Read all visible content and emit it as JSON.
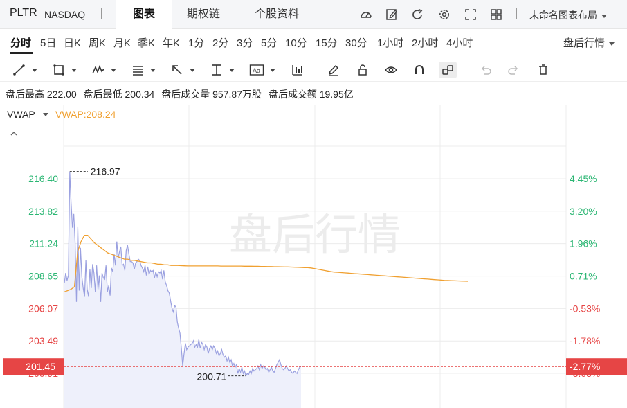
{
  "header": {
    "ticker": "PLTR",
    "exchange": "NASDAQ",
    "tabs": [
      {
        "label": "图表",
        "active": true
      },
      {
        "label": "期权链",
        "active": false
      },
      {
        "label": "个股资料",
        "active": false
      }
    ],
    "layout_name": "未命名图表布局"
  },
  "periods": [
    {
      "label": "分时",
      "active": true
    },
    {
      "label": "5日"
    },
    {
      "label": "日K"
    },
    {
      "label": "周K"
    },
    {
      "label": "月K"
    },
    {
      "label": "季K"
    },
    {
      "label": "年K"
    },
    {
      "label": "1分"
    },
    {
      "label": "2分"
    },
    {
      "label": "3分"
    },
    {
      "label": "5分"
    },
    {
      "label": "10分"
    },
    {
      "label": "15分"
    },
    {
      "label": "30分"
    },
    {
      "label": "1小时"
    },
    {
      "label": "2小时"
    },
    {
      "label": "4小时"
    }
  ],
  "session_selector": "盘后行情",
  "stats": {
    "high_label": "盘后最高",
    "high_value": "222.00",
    "low_label": "盘后最低",
    "low_value": "200.34",
    "volume_label": "盘后成交量",
    "volume_value": "957.87万股",
    "turnover_label": "盘后成交额",
    "turnover_value": "19.95亿"
  },
  "indicator": {
    "name": "VWAP",
    "value_text": "VWAP:208.24"
  },
  "colors": {
    "price_line": "#9aa0e0",
    "price_fill": "#eef0fb",
    "vwap": "#f0a030",
    "up": "#2bb673",
    "down": "#e64545",
    "grid": "#ececec"
  },
  "chart_data": {
    "type": "line",
    "watermark": "盘后行情",
    "y_price_ticks": [
      "216.40",
      "213.82",
      "211.24",
      "208.65",
      "206.07",
      "203.49",
      "200.91"
    ],
    "y_price_values": [
      216.4,
      213.82,
      211.24,
      208.65,
      206.07,
      203.49,
      200.91
    ],
    "y_pct_ticks": [
      "4.45%",
      "3.20%",
      "1.96%",
      "0.71%",
      "-0.53%",
      "-1.78%",
      "-3.03%"
    ],
    "last_price": {
      "value": 201.45,
      "label": "201.45",
      "pct_label": "-2.77%"
    },
    "max_annotation": {
      "value": 216.97,
      "label": "216.97"
    },
    "min_annotation": {
      "value": 200.71,
      "label": "200.71"
    },
    "x": [
      0,
      2,
      4,
      6,
      8,
      10,
      12,
      14,
      16,
      18,
      20,
      22,
      24,
      26,
      28,
      30,
      32,
      34,
      36,
      38,
      40,
      42,
      44,
      46,
      48,
      50,
      52,
      54,
      56,
      58,
      60,
      62,
      64,
      66,
      68,
      70,
      72,
      74,
      76,
      78,
      80,
      82,
      84,
      86,
      88,
      90,
      92,
      94,
      96,
      98,
      100,
      102,
      104,
      106,
      108,
      110,
      112,
      114,
      116,
      118,
      120,
      122,
      124,
      126,
      128,
      130,
      132,
      134,
      136,
      138,
      140,
      142,
      144,
      146,
      148,
      150,
      152,
      154,
      156,
      158,
      160,
      162,
      164,
      166,
      168,
      170,
      172,
      174,
      176,
      178,
      180,
      182,
      184,
      186,
      188,
      190,
      192,
      194,
      196,
      198,
      200,
      202,
      204,
      206,
      208,
      210,
      212,
      214,
      216,
      218,
      220,
      222,
      224,
      226,
      228,
      230,
      232,
      234,
      236,
      238,
      240,
      242,
      244,
      246,
      248,
      250,
      252,
      254,
      256,
      258,
      260,
      262,
      264,
      266,
      268,
      270,
      272,
      274,
      276,
      278,
      280,
      282,
      284,
      286,
      288,
      290,
      292,
      294,
      296,
      298,
      300,
      302,
      304,
      306,
      308,
      310,
      312,
      314,
      316,
      318,
      320,
      322,
      324,
      326,
      328,
      330,
      332,
      334,
      336,
      338,
      340,
      342,
      344,
      346,
      348,
      350,
      352,
      354,
      356,
      358,
      360,
      362,
      364,
      366,
      368,
      370,
      372,
      374,
      376,
      378,
      380,
      382,
      384,
      386,
      388,
      390,
      392,
      394,
      396,
      398,
      400,
      402,
      404,
      406,
      408,
      410,
      412,
      414,
      416,
      418,
      420,
      422,
      424,
      426,
      428,
      430,
      432,
      434,
      436,
      438,
      440,
      442,
      444,
      446,
      448,
      450,
      452,
      454,
      456,
      458,
      460,
      462,
      464,
      466,
      468,
      470,
      472,
      474,
      476,
      478,
      480,
      482,
      484,
      486,
      488,
      490,
      492,
      494,
      496,
      498,
      500,
      502,
      504,
      506,
      508,
      510,
      512,
      514,
      516,
      518,
      520,
      522,
      524,
      526,
      528,
      530,
      532,
      534,
      536,
      538,
      540,
      542,
      544,
      546,
      548,
      550,
      552,
      554,
      556,
      558,
      560,
      562,
      564,
      566,
      568,
      570,
      572,
      574,
      576,
      578,
      580,
      582,
      584,
      586,
      588,
      590,
      592,
      594,
      596,
      598,
      600
    ],
    "price": [
      208.1,
      208.9,
      208.3,
      208.7,
      216.97,
      214.5,
      212.5,
      213.6,
      211.4,
      206.6,
      212.6,
      207.5,
      210.9,
      208.6,
      207.7,
      207.0,
      209.9,
      207.6,
      207.0,
      209.2,
      207.7,
      209.6,
      208.9,
      207.4,
      209.5,
      207.6,
      208.7,
      206.6,
      208.9,
      208.5,
      208.4,
      209.5,
      207.4,
      207.9,
      207.1,
      209.3,
      209.0,
      210.4,
      209.5,
      211.4,
      210.1,
      210.6,
      211.0,
      209.5,
      209.6,
      209.1,
      210.7,
      211.1,
      210.4,
      209.8,
      209.8,
      209.7,
      209.2,
      209.7,
      209.8,
      210.0,
      209.9,
      209.5,
      209.3,
      209.0,
      209.5,
      208.7,
      209.4,
      208.8,
      209.1,
      209.0,
      209.1,
      208.5,
      209.0,
      208.6,
      209.0,
      208.9,
      209.1,
      208.4,
      209.1,
      208.2,
      207.9,
      207.5,
      207.3,
      206.7,
      206.1,
      205.8,
      206.3,
      206.2,
      205.0,
      204.5,
      204.1,
      202.9,
      201.5,
      202.5,
      203.3,
      202.8,
      203.0,
      203.1,
      203.2,
      203.3,
      203.5,
      203.0,
      203.2,
      203.0,
      203.6,
      202.9,
      203.4,
      203.2,
      202.8,
      203.2,
      203.0,
      202.5,
      202.9,
      203.1,
      202.8,
      203.1,
      202.9,
      202.5,
      202.7,
      202.3,
      202.5,
      202.8,
      202.4,
      202.2,
      202.3,
      201.9,
      202.2,
      201.8,
      202.0,
      201.5,
      201.7,
      201.4,
      201.6,
      200.9,
      201.3,
      201.0,
      201.4,
      200.9,
      201.1,
      200.71,
      200.9,
      200.8,
      201.1,
      200.9,
      201.3,
      201.1,
      201.2,
      201.3,
      201.5,
      201.2,
      201.6,
      201.3,
      201.5,
      201.4,
      201.2,
      201.3,
      201.0,
      201.2,
      201.4,
      201.1,
      201.0,
      201.3,
      201.6,
      201.8,
      202.0,
      201.6,
      201.3,
      201.2,
      201.3,
      201.5,
      201.3,
      201.1,
      201.2,
      201.0,
      200.9,
      201.1,
      201.0,
      200.9,
      201.2,
      201.4,
      201.45
    ],
    "vwap": [
      207.4,
      207.5,
      207.6,
      207.8,
      210.6,
      211.4,
      211.9,
      211.9,
      211.6,
      211.3,
      211.1,
      210.9,
      210.7,
      210.5,
      210.4,
      210.3,
      210.2,
      210.1,
      210.0,
      210.0,
      209.9,
      209.9,
      209.85,
      209.8,
      209.75,
      209.7,
      209.7,
      209.65,
      209.6,
      209.6,
      209.55,
      209.55,
      209.5,
      209.5,
      209.5,
      209.48,
      209.47,
      209.46,
      209.46,
      209.46,
      209.46,
      209.46,
      209.46,
      209.46,
      209.46,
      209.46,
      209.46,
      209.45,
      209.45,
      209.45,
      209.45,
      209.45,
      209.45,
      209.45,
      209.44,
      209.44,
      209.44,
      209.43,
      209.43,
      209.42,
      209.42,
      209.41,
      209.41,
      209.4,
      209.4,
      209.39,
      209.38,
      209.38,
      209.37,
      209.36,
      209.35,
      209.34,
      209.33,
      209.32,
      209.3,
      209.25,
      209.2,
      209.15,
      209.1,
      209.05,
      209.0,
      208.97,
      208.95,
      208.93,
      208.91,
      208.89,
      208.87,
      208.85,
      208.83,
      208.81,
      208.79,
      208.77,
      208.75,
      208.73,
      208.71,
      208.69,
      208.67,
      208.65,
      208.63,
      208.61,
      208.59,
      208.57,
      208.55,
      208.53,
      208.51,
      208.49,
      208.47,
      208.45,
      208.43,
      208.41,
      208.39,
      208.37,
      208.35,
      208.33,
      208.31,
      208.3,
      208.29,
      208.28,
      208.27,
      208.26,
      208.25,
      208.24
    ]
  }
}
